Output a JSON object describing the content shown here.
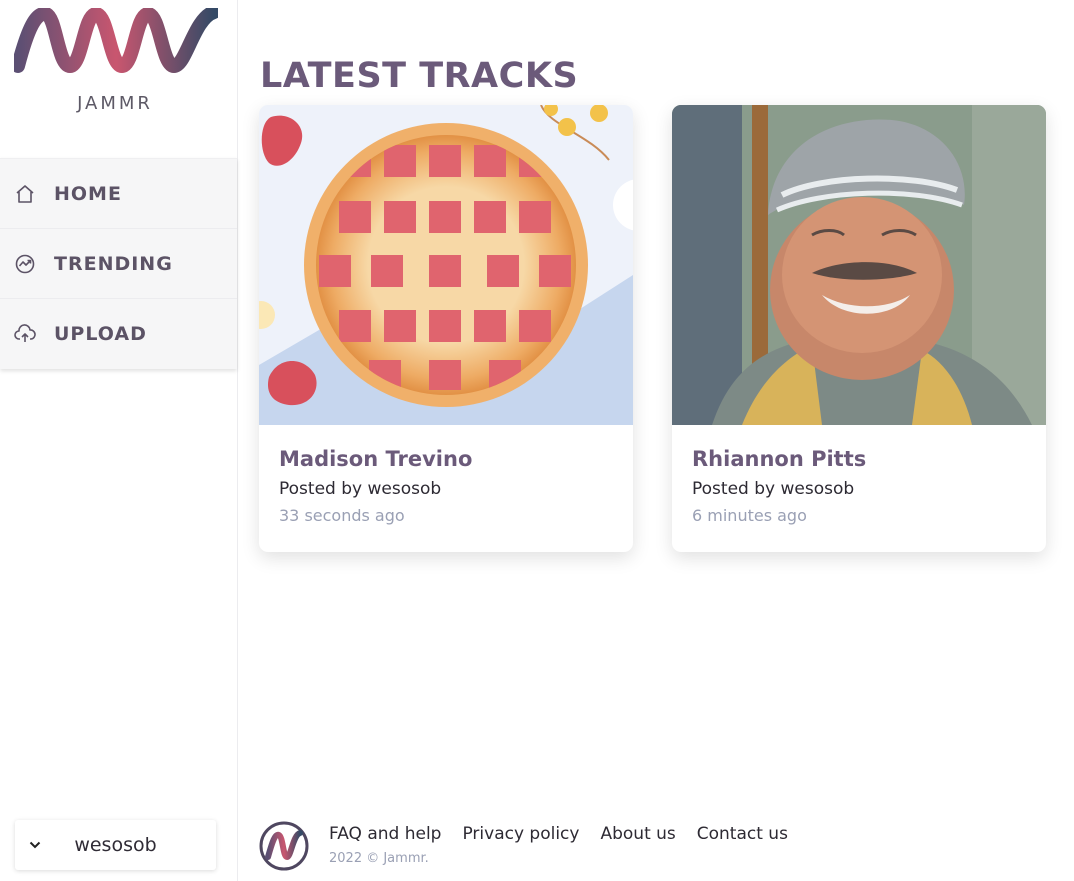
{
  "brand": {
    "name": "JAMMR",
    "colors": {
      "accent": "#6b5a7a",
      "pink": "#c9566f",
      "navy": "#344a66"
    }
  },
  "sidebar": {
    "items": [
      {
        "label": "HOME",
        "icon": "home-icon"
      },
      {
        "label": "TRENDING",
        "icon": "trending-icon"
      },
      {
        "label": "UPLOAD",
        "icon": "cloud-upload-icon"
      }
    ],
    "user": {
      "name": "wesosob",
      "icon": "chevron-down-icon"
    }
  },
  "main": {
    "title": "LATEST TRACKS",
    "tracks": [
      {
        "title": "Madison Trevino",
        "posted_by": "Posted by wesosob",
        "time": "33 seconds ago",
        "image": "pie-illustration"
      },
      {
        "title": "Rhiannon Pitts",
        "posted_by": "Posted by wesosob",
        "time": "6 minutes ago",
        "image": "smiling-man-photo"
      }
    ]
  },
  "footer": {
    "links": [
      "FAQ and help",
      "Privacy policy",
      "About us",
      "Contact us"
    ],
    "copyright": "2022 © Jammr."
  }
}
